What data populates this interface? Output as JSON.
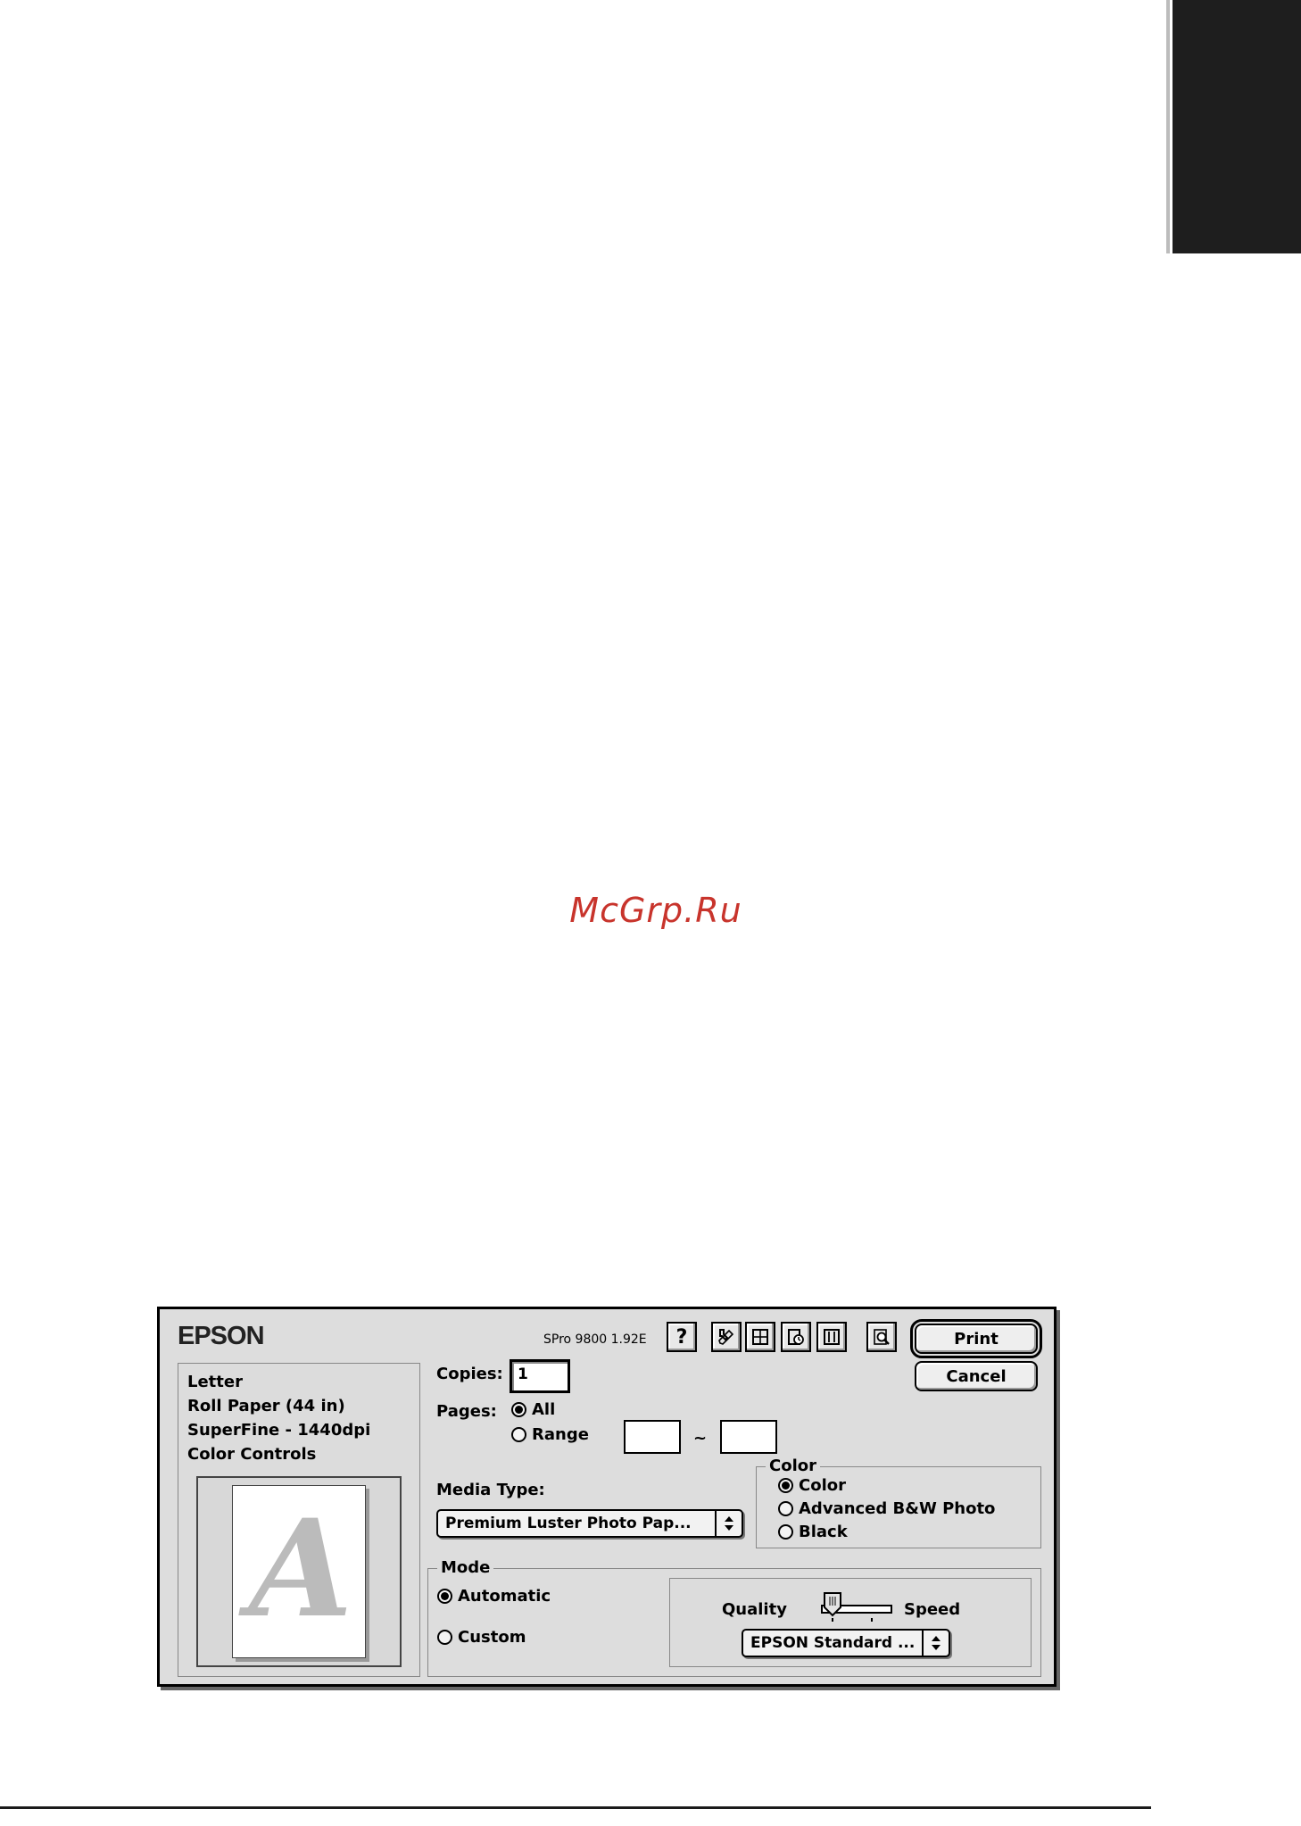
{
  "watermark": "McGrp.Ru",
  "dialog": {
    "brand": "EPSON",
    "version": "SPro 9800 1.92E",
    "toolbar": {
      "help_label": "?",
      "icons": [
        "utility-icon",
        "layout-icon",
        "background-print-icon",
        "print-margins-icon",
        "preview-icon"
      ]
    },
    "buttons": {
      "print": "Print",
      "cancel": "Cancel"
    },
    "summary": [
      "Letter",
      "Roll Paper (44 in)",
      "SuperFine - 1440dpi",
      "Color Controls"
    ],
    "preview_letter": "A",
    "copies": {
      "label": "Copies:",
      "value": "1"
    },
    "pages": {
      "label": "Pages:",
      "all": "All",
      "range": "Range",
      "separator": "~",
      "selected": "All"
    },
    "media_type": {
      "label": "Media Type:",
      "value": "Premium Luster Photo Pap..."
    },
    "color": {
      "label": "Color",
      "options": [
        "Color",
        "Advanced B&W Photo",
        "Black"
      ],
      "selected": "Color"
    },
    "mode": {
      "label": "Mode",
      "options": [
        "Automatic",
        "Custom"
      ],
      "selected": "Automatic",
      "quality_label": "Quality",
      "speed_label": "Speed",
      "slider_level": 0,
      "setting": "EPSON Standard ..."
    }
  }
}
